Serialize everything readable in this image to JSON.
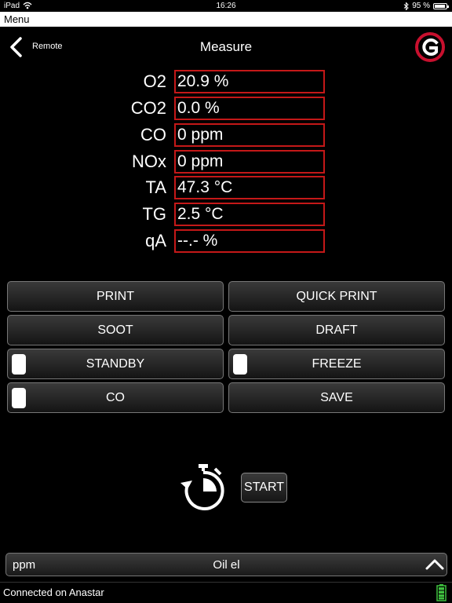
{
  "status_bar": {
    "device": "iPad",
    "time": "16:26",
    "battery": "95 %",
    "battery_level": 0.95
  },
  "menu": {
    "label": "Menu"
  },
  "header": {
    "back_label": "Remote",
    "title": "Measure"
  },
  "measurements": [
    {
      "label": "O2",
      "value": "20.9 %"
    },
    {
      "label": "CO2",
      "value": "0.0 %"
    },
    {
      "label": "CO",
      "value": "0 ppm"
    },
    {
      "label": "NOx",
      "value": "0 ppm"
    },
    {
      "label": "TA",
      "value": "47.3 °C"
    },
    {
      "label": "TG",
      "value": "2.5 °C"
    },
    {
      "label": "qA",
      "value": "--.- %"
    }
  ],
  "buttons": {
    "print": "PRINT",
    "quick_print": "QUICK PRINT",
    "soot": "SOOT",
    "draft": "DRAFT",
    "standby": "STANDBY",
    "freeze": "FREEZE",
    "co": "CO",
    "save": "SAVE"
  },
  "timer": {
    "start_label": "START"
  },
  "bottom_bar": {
    "unit": "ppm",
    "fuel": "Oil el"
  },
  "footer": {
    "connection": "Connected on Anastar"
  },
  "colors": {
    "value_border": "#c41818",
    "logo_red": "#c8102e",
    "battery_green": "#3fbf3f"
  }
}
